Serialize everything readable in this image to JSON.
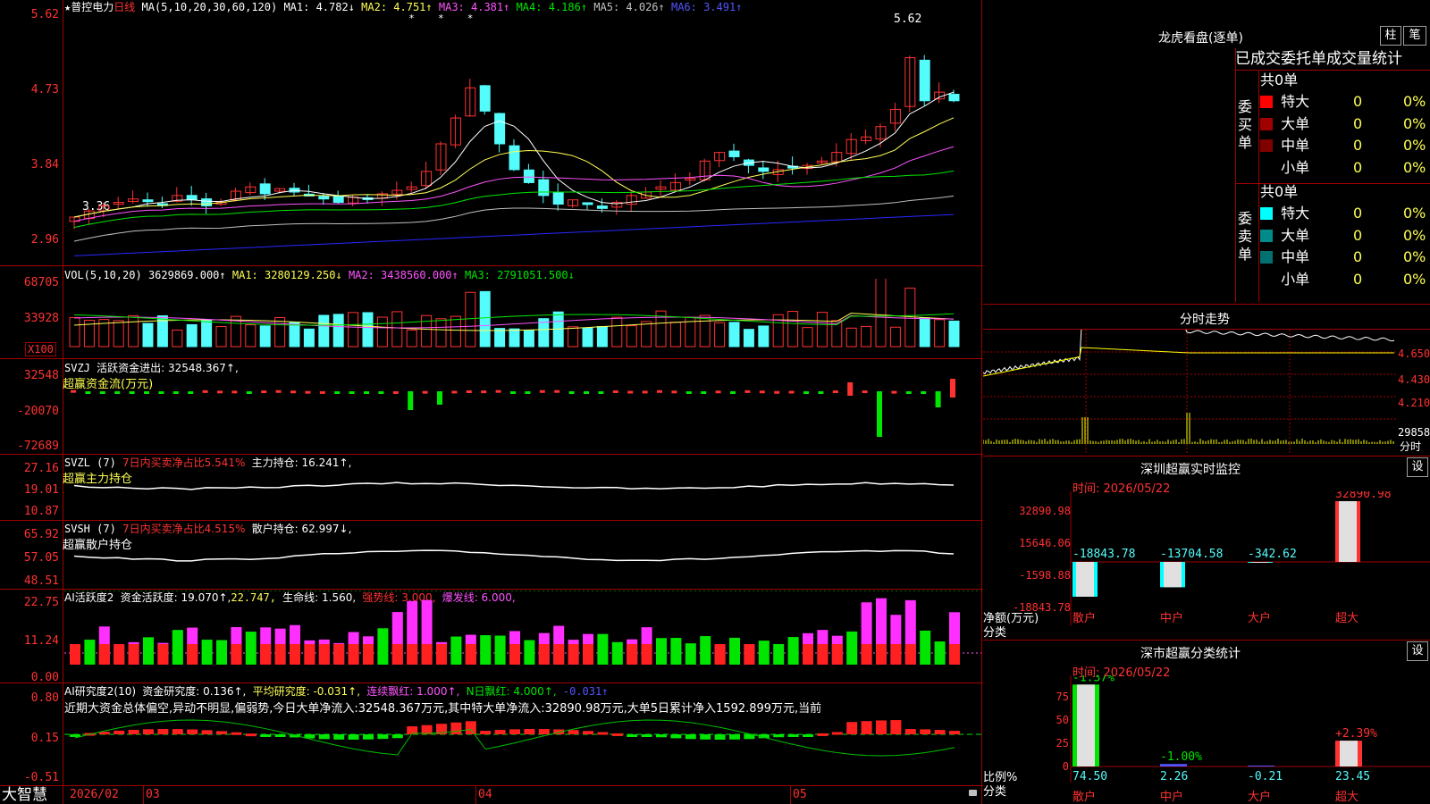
{
  "kline": {
    "title_star": "★",
    "stock_name": "普控电力",
    "period": "日线",
    "ma_params": "MA(5,10,20,30,60,120)",
    "ma": [
      {
        "label": "MA1:",
        "value": "4.782↓",
        "color": "#ffffff"
      },
      {
        "label": "MA2:",
        "value": "4.751↑",
        "color": "#ffff54"
      },
      {
        "label": "MA3:",
        "value": "4.381↑",
        "color": "#ff54ff"
      },
      {
        "label": "MA4:",
        "value": "4.186↑",
        "color": "#00e600"
      },
      {
        "label": "MA5:",
        "value": "4.026↑",
        "color": "#c0c0c0"
      },
      {
        "label": "MA6:",
        "value": "3.491↑",
        "color": "#5454ff"
      }
    ],
    "y_ticks": [
      "5.62",
      "4.73",
      "3.84",
      "2.96"
    ],
    "high_label": "5.62",
    "low_label": "3.36"
  },
  "vol": {
    "params": "VOL(5,10,20)",
    "value": "3629869.000↑",
    "ma1": "MA1: 3280129.250↓",
    "ma2": "MA2: 3438560.000↑",
    "ma3": "MA3: 2791051.500↓",
    "y_ticks": [
      "68705",
      "33928"
    ],
    "unit": "X100"
  },
  "svzj": {
    "name": "SVZJ",
    "label": "活跃资金进出: 32548.367↑,",
    "sub": "超赢资金流(万元)",
    "y_ticks": [
      "32548",
      "-20070",
      "-72689"
    ]
  },
  "svzl": {
    "name": "SVZL (7)",
    "label1": "7日内买卖净占比5.541%",
    "label2": "主力持仓: 16.241↑,",
    "sub": "超赢主力持仓",
    "y_ticks": [
      "27.16",
      "19.01",
      "10.87"
    ]
  },
  "svsh": {
    "name": "SVSH (7)",
    "label1": "7日内买卖净占比4.515%",
    "label2": "散户持仓: 62.997↓,",
    "sub": "超赢散户持仓",
    "y_ticks": [
      "65.92",
      "57.05",
      "48.51"
    ]
  },
  "ai1": {
    "name": "AI活跃度2",
    "label": "资金活跃度: 19.070↑,",
    "v2": "22.747,",
    "life": "生命线: 1.560,",
    "strong": "强势线: 3.000,",
    "burst": "爆发线: 6.000,",
    "y_ticks": [
      "22.75",
      "11.24",
      "0.00"
    ]
  },
  "ai2": {
    "name": "AI研究度2(10)",
    "label": "资金研究度: 0.136↑,",
    "avg": "平均研究度: -0.031↑,",
    "cont": "连续飘红: 1.000↑,",
    "nday": "N日飘红: 4.000↑,",
    "last": "-0.031↑",
    "comment": "近期大资金总体偏空,异动不明显,偏弱势,今日大单净流入:32548.367万元,其中特大单净流入:32890.98万元,大单5日累计净入1592.899万元,当前",
    "y_ticks": [
      "0.80",
      "0.15",
      "-0.51"
    ]
  },
  "xaxis": {
    "brand": "大智慧",
    "labels": [
      "2026/02",
      "03",
      "04",
      "05"
    ]
  },
  "longhu": {
    "title": "龙虎看盘(逐单)",
    "btn1": "柱",
    "btn2": "笔",
    "tabs": "已成交委托单成交量统计",
    "buy_label": "委买单",
    "sell_label": "委卖单",
    "buy_total": "共0单",
    "sell_total": "共0单",
    "buy_rows": [
      {
        "name": "特大",
        "count": "0",
        "pct": "0%",
        "color": "#ff0000"
      },
      {
        "name": "大单",
        "count": "0",
        "pct": "0%",
        "color": "#a00000"
      },
      {
        "name": "中单",
        "count": "0",
        "pct": "0%",
        "color": "#800000"
      },
      {
        "name": "小单",
        "count": "0",
        "pct": "0%",
        "color": ""
      }
    ],
    "sell_rows": [
      {
        "name": "特大",
        "count": "0",
        "pct": "0%",
        "color": "#00ffff"
      },
      {
        "name": "大单",
        "count": "0",
        "pct": "0%",
        "color": "#008a8a"
      },
      {
        "name": "中单",
        "count": "0",
        "pct": "0%",
        "color": "#007070"
      },
      {
        "name": "小单",
        "count": "0",
        "pct": "0%",
        "color": ""
      }
    ]
  },
  "fenshi": {
    "title": "分时走势",
    "right_ticks": [
      "4.650",
      "4.430",
      "4.210",
      "29858"
    ],
    "vol_unit": "分时"
  },
  "sz_monitor": {
    "title": "深圳超赢实时监控",
    "btn": "设",
    "time": "时间: 2026/05/22",
    "y_ticks": [
      "32890.98",
      "15646.06",
      "-1598.88",
      "-18843.78"
    ],
    "bars": [
      {
        "cat": "散户",
        "value": "-18843.78"
      },
      {
        "cat": "中户",
        "value": "-13704.58"
      },
      {
        "cat": "大户",
        "value": "-342.62"
      },
      {
        "cat": "超大",
        "value": "32890.98"
      }
    ],
    "ylabel": "净额(万元)",
    "xlabel": "分类"
  },
  "sz_class": {
    "title": "深市超赢分类统计",
    "btn": "设",
    "time": "时间: 2026/05/22",
    "y_ticks": [
      "75",
      "50",
      "25",
      "0"
    ],
    "bars": [
      {
        "cat": "散户",
        "ratio": "74.50",
        "change": "-1.37%"
      },
      {
        "cat": "中户",
        "ratio": "2.26",
        "change": "-1.00%"
      },
      {
        "cat": "大户",
        "ratio": "-0.21",
        "change": ""
      },
      {
        "cat": "超大",
        "ratio": "23.45",
        "change": "+2.39%"
      }
    ],
    "ylabel": "比例%",
    "xlabel": "分类"
  },
  "colors": {
    "up": "#ff3232",
    "down": "#54fcfc",
    "frame": "#a00000"
  }
}
